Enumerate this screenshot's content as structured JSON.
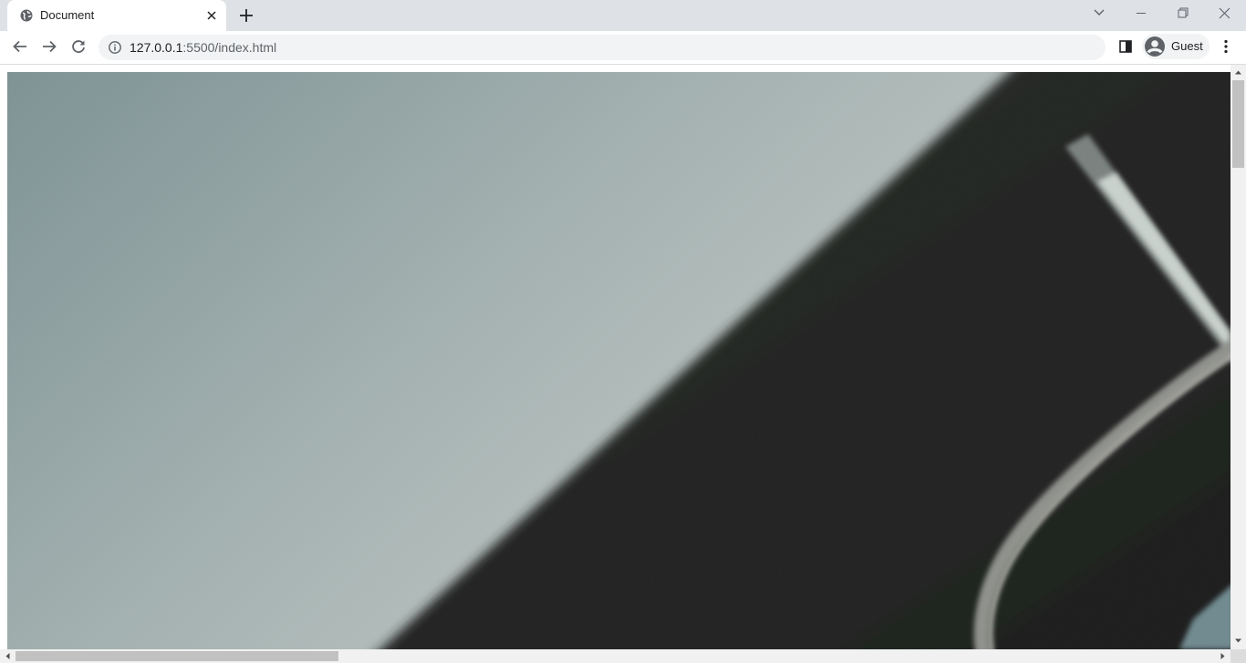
{
  "browser": {
    "tab": {
      "title": "Document",
      "favicon": "globe-icon"
    },
    "new_tab_icon": "plus-icon",
    "tab_search_icon": "chevron-down-icon",
    "window_controls": [
      "minimize-icon",
      "restore-icon",
      "close-icon"
    ],
    "nav_icons": [
      "back-arrow-icon",
      "forward-arrow-icon",
      "reload-icon"
    ],
    "address_bar": {
      "site_info_icon": "info-icon",
      "url_host": "127.0.0.1",
      "url_rest": ":5500/index.html"
    },
    "side_panel_icon": "side-panel-icon",
    "profile": {
      "label": "Guest",
      "icon": "avatar-icon"
    },
    "menu_icon": "kebab-menu-icon"
  },
  "page": {
    "content": "full-page-photo",
    "colors": {
      "sky_light": "#b9c3c1",
      "sky_dark": "#7e9294",
      "object_dark": "#1e1f1e"
    }
  }
}
